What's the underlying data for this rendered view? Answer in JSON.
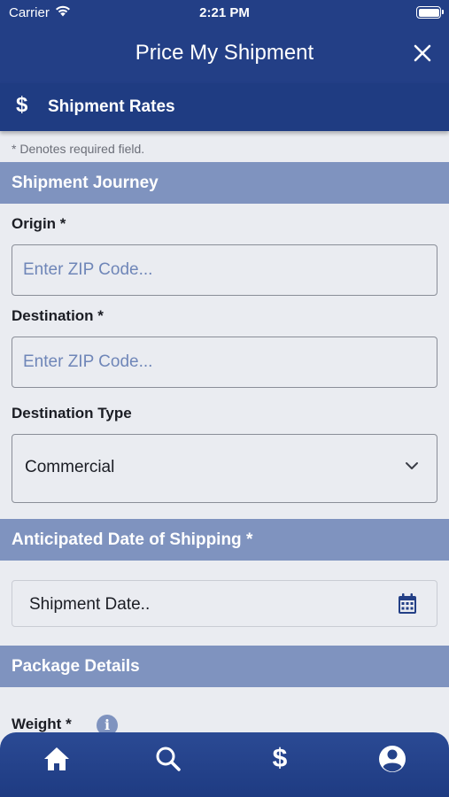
{
  "status_bar": {
    "carrier": "Carrier",
    "time": "2:21 PM"
  },
  "nav": {
    "title": "Price My Shipment",
    "close_icon": "close-icon"
  },
  "section": {
    "icon": "dollar-icon",
    "label": "Shipment Rates"
  },
  "required_note": "* Denotes required field.",
  "journey": {
    "header": "Shipment Journey",
    "origin_label": "Origin *",
    "origin_placeholder": "Enter ZIP Code...",
    "destination_label": "Destination *",
    "destination_placeholder": "Enter ZIP Code...",
    "destination_type_label": "Destination Type",
    "destination_type_value": "Commercial"
  },
  "shipping_date": {
    "header": "Anticipated Date of Shipping *",
    "placeholder": "Shipment Date..",
    "icon": "calendar-icon"
  },
  "package": {
    "header": "Package Details",
    "weight_label": "Weight *",
    "info_icon": "info-icon"
  },
  "tabs": [
    {
      "name": "home",
      "icon": "home-icon"
    },
    {
      "name": "search",
      "icon": "search-icon"
    },
    {
      "name": "price",
      "icon": "dollar-icon"
    },
    {
      "name": "account",
      "icon": "account-icon"
    }
  ],
  "colors": {
    "primary": "#233f86",
    "section_header": "#7f93bf",
    "background": "#eaecf1",
    "placeholder": "#6f86b8"
  }
}
